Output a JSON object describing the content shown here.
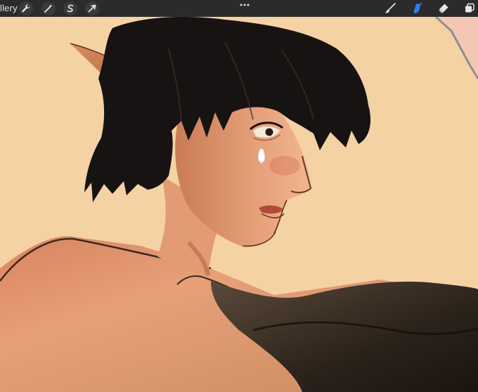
{
  "toolbar": {
    "gallery_label": "llery",
    "left_tools": [
      "wrench-icon",
      "magic-wand-icon",
      "selection-icon",
      "transform-arrow-icon"
    ],
    "right_tools": [
      "brush-icon",
      "smudge-icon",
      "eraser-icon",
      "layers-icon"
    ],
    "active_tool": "smudge-icon",
    "more_menu": "more-dots-icon"
  },
  "colors": {
    "toolbar_bg": "#2b2b2b",
    "canvas_bg": "#f5d2a4",
    "active_tool": "#2f7cf6",
    "hair": "#171312",
    "skin": "#e9a478"
  }
}
